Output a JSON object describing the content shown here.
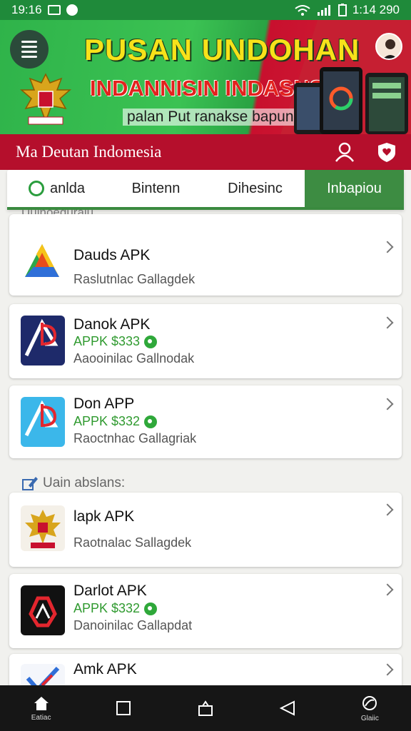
{
  "status": {
    "time": "19:16",
    "right_text": "1:14 290"
  },
  "banner": {
    "title": "PUSAN UNDOHAN",
    "subtitle": "INDANNISIN INDASNSIA",
    "tagline": "palan Put ranakse bapun"
  },
  "header": {
    "title": "Ma Deutan Indomesia"
  },
  "tabs": [
    {
      "label": "anlda",
      "active": false
    },
    {
      "label": "Bintenn",
      "active": false
    },
    {
      "label": "Dihesinc",
      "active": false
    },
    {
      "label": "Inbapiou",
      "active": true
    }
  ],
  "sections": {
    "top_partial": "Uuinoeduraiu",
    "second": "Uain abslans:"
  },
  "apps": [
    {
      "name": "Dauds APK",
      "price": "",
      "developer": "Raslutnlac Gallagdek",
      "icon": "triangle-colorful-icon"
    },
    {
      "name": "Danok APK",
      "price": "APPK $333",
      "developer": "Aaooinilac Gallnodak",
      "icon": "ap-logo-icon"
    },
    {
      "name": "Don APP",
      "price": "APPK $332",
      "developer": "Raoctnhac Gallagriak",
      "icon": "ap-blue-logo-icon"
    },
    {
      "name": "lapk APK",
      "price": "",
      "developer": "Raotnalac Sallagdek",
      "icon": "garuda-emblem-icon"
    },
    {
      "name": "Darlot APK",
      "price": "APPK $332",
      "developer": "Danoinilac Gallapdat",
      "icon": "red-triangle-logo-icon"
    },
    {
      "name": "Amk APK",
      "price": "",
      "developer": "",
      "icon": "blue-check-logo-icon"
    }
  ],
  "nav": [
    {
      "label": "Eatiac",
      "icon": "home-icon"
    },
    {
      "label": "",
      "icon": "square-icon"
    },
    {
      "label": "",
      "icon": "bag-icon"
    },
    {
      "label": "",
      "icon": "back-triangle-icon"
    },
    {
      "label": "Glaiic",
      "icon": "globe-icon"
    }
  ],
  "colors": {
    "green": "#3d8c42",
    "red": "#b50f2c",
    "price_green": "#2f9a2f"
  }
}
